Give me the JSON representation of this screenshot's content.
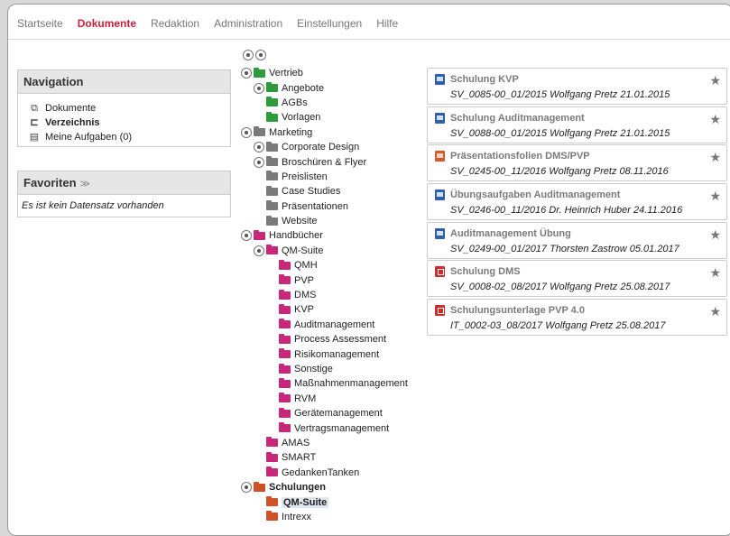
{
  "topnav": {
    "tabs": [
      {
        "label": "Startseite",
        "active": false
      },
      {
        "label": "Dokumente",
        "active": true
      },
      {
        "label": "Redaktion",
        "active": false
      },
      {
        "label": "Administration",
        "active": false
      },
      {
        "label": "Einstellungen",
        "active": false
      },
      {
        "label": "Hilfe",
        "active": false
      }
    ]
  },
  "navigation": {
    "title": "Navigation",
    "items": [
      {
        "label": "Dokumente",
        "icon": "documents-icon",
        "bold": false
      },
      {
        "label": "Verzeichnis",
        "icon": "directory-icon",
        "bold": true
      },
      {
        "label": "Meine Aufgaben (0)",
        "icon": "clipboard-icon",
        "bold": false
      }
    ]
  },
  "favorites": {
    "title": "Favoriten",
    "toggle_icon": "double-chevron-down-icon",
    "empty_text": "Es ist kein Datensatz vorhanden"
  },
  "tree": [
    {
      "label": "Vertrieb",
      "level": 0,
      "toggle": true,
      "color": "#2e9b3c",
      "bold": false
    },
    {
      "label": "Angebote",
      "level": 1,
      "toggle": true,
      "color": "#2e9b3c",
      "bold": false
    },
    {
      "label": "AGBs",
      "level": 1,
      "toggle": false,
      "color": "#2e9b3c",
      "bold": false
    },
    {
      "label": "Vorlagen",
      "level": 1,
      "toggle": false,
      "color": "#2e9b3c",
      "bold": false
    },
    {
      "label": "Marketing",
      "level": 0,
      "toggle": true,
      "color": "#7a7a7a",
      "bold": false
    },
    {
      "label": "Corporate Design",
      "level": 1,
      "toggle": true,
      "color": "#7a7a7a",
      "bold": false
    },
    {
      "label": "Broschüren & Flyer",
      "level": 1,
      "toggle": true,
      "color": "#7a7a7a",
      "bold": false
    },
    {
      "label": "Preislisten",
      "level": 1,
      "toggle": false,
      "color": "#7a7a7a",
      "bold": false
    },
    {
      "label": "Case Studies",
      "level": 1,
      "toggle": false,
      "color": "#7a7a7a",
      "bold": false
    },
    {
      "label": "Präsentationen",
      "level": 1,
      "toggle": false,
      "color": "#7a7a7a",
      "bold": false
    },
    {
      "label": "Website",
      "level": 1,
      "toggle": false,
      "color": "#7a7a7a",
      "bold": false
    },
    {
      "label": "Handbücher",
      "level": 0,
      "toggle": true,
      "color": "#c8287a",
      "bold": false
    },
    {
      "label": "QM-Suite",
      "level": 1,
      "toggle": true,
      "color": "#c8287a",
      "bold": false
    },
    {
      "label": "QMH",
      "level": 2,
      "toggle": false,
      "color": "#c8287a",
      "bold": false
    },
    {
      "label": "PVP",
      "level": 2,
      "toggle": false,
      "color": "#c8287a",
      "bold": false
    },
    {
      "label": "DMS",
      "level": 2,
      "toggle": false,
      "color": "#c8287a",
      "bold": false
    },
    {
      "label": "KVP",
      "level": 2,
      "toggle": false,
      "color": "#c8287a",
      "bold": false
    },
    {
      "label": "Auditmanagement",
      "level": 2,
      "toggle": false,
      "color": "#c8287a",
      "bold": false
    },
    {
      "label": "Process Assessment",
      "level": 2,
      "toggle": false,
      "color": "#c8287a",
      "bold": false
    },
    {
      "label": "Risikomanagement",
      "level": 2,
      "toggle": false,
      "color": "#c8287a",
      "bold": false
    },
    {
      "label": "Sonstige",
      "level": 2,
      "toggle": false,
      "color": "#c8287a",
      "bold": false
    },
    {
      "label": "Maßnahmenmanagement",
      "level": 2,
      "toggle": false,
      "color": "#c8287a",
      "bold": false
    },
    {
      "label": "RVM",
      "level": 2,
      "toggle": false,
      "color": "#c8287a",
      "bold": false
    },
    {
      "label": "Gerätemanagement",
      "level": 2,
      "toggle": false,
      "color": "#c8287a",
      "bold": false
    },
    {
      "label": "Vertragsmanagement",
      "level": 2,
      "toggle": false,
      "color": "#c8287a",
      "bold": false
    },
    {
      "label": "AMAS",
      "level": 1,
      "toggle": false,
      "color": "#c8287a",
      "bold": false
    },
    {
      "label": "SMART",
      "level": 1,
      "toggle": false,
      "color": "#c8287a",
      "bold": false
    },
    {
      "label": "GedankenTanken",
      "level": 1,
      "toggle": false,
      "color": "#c8287a",
      "bold": false
    },
    {
      "label": "Schulungen",
      "level": 0,
      "toggle": true,
      "color": "#d0502a",
      "bold": true
    },
    {
      "label": "QM-Suite",
      "level": 1,
      "toggle": false,
      "color": "#d0502a",
      "bold": true,
      "selected": true
    },
    {
      "label": "Intrexx",
      "level": 1,
      "toggle": false,
      "color": "#d0502a",
      "bold": false
    }
  ],
  "documents": [
    {
      "title": "Schulung KVP",
      "icon": "word-document-icon",
      "meta": "SV_0085-00_01/2015 Wolfgang Pretz 21.01.2015"
    },
    {
      "title": "Schulung Auditmanagement",
      "icon": "word-document-icon",
      "meta": "SV_0088-00_01/2015 Wolfgang Pretz 21.01.2015"
    },
    {
      "title": "Präsentationsfolien DMS/PVP",
      "icon": "powerpoint-document-icon",
      "meta": "SV_0245-00_11/2016 Wolfgang Pretz 08.11.2016"
    },
    {
      "title": "Übungsaufgaben Auditmanagement",
      "icon": "word-document-icon",
      "meta": "SV_0246-00_11/2016 Dr. Heinrich Huber 24.11.2016"
    },
    {
      "title": "Auditmanagement Übung",
      "icon": "word-document-icon",
      "meta": "SV_0249-00_01/2017 Thorsten Zastrow 05.01.2017"
    },
    {
      "title": "Schulung DMS",
      "icon": "pdf-document-icon",
      "meta": "SV_0008-02_08/2017 Wolfgang Pretz 25.08.2017"
    },
    {
      "title": "Schulungsunterlage PVP 4.0",
      "icon": "pdf-document-icon",
      "meta": "IT_0002-03_08/2017 Wolfgang Pretz 25.08.2017"
    }
  ],
  "star_glyph": "★"
}
